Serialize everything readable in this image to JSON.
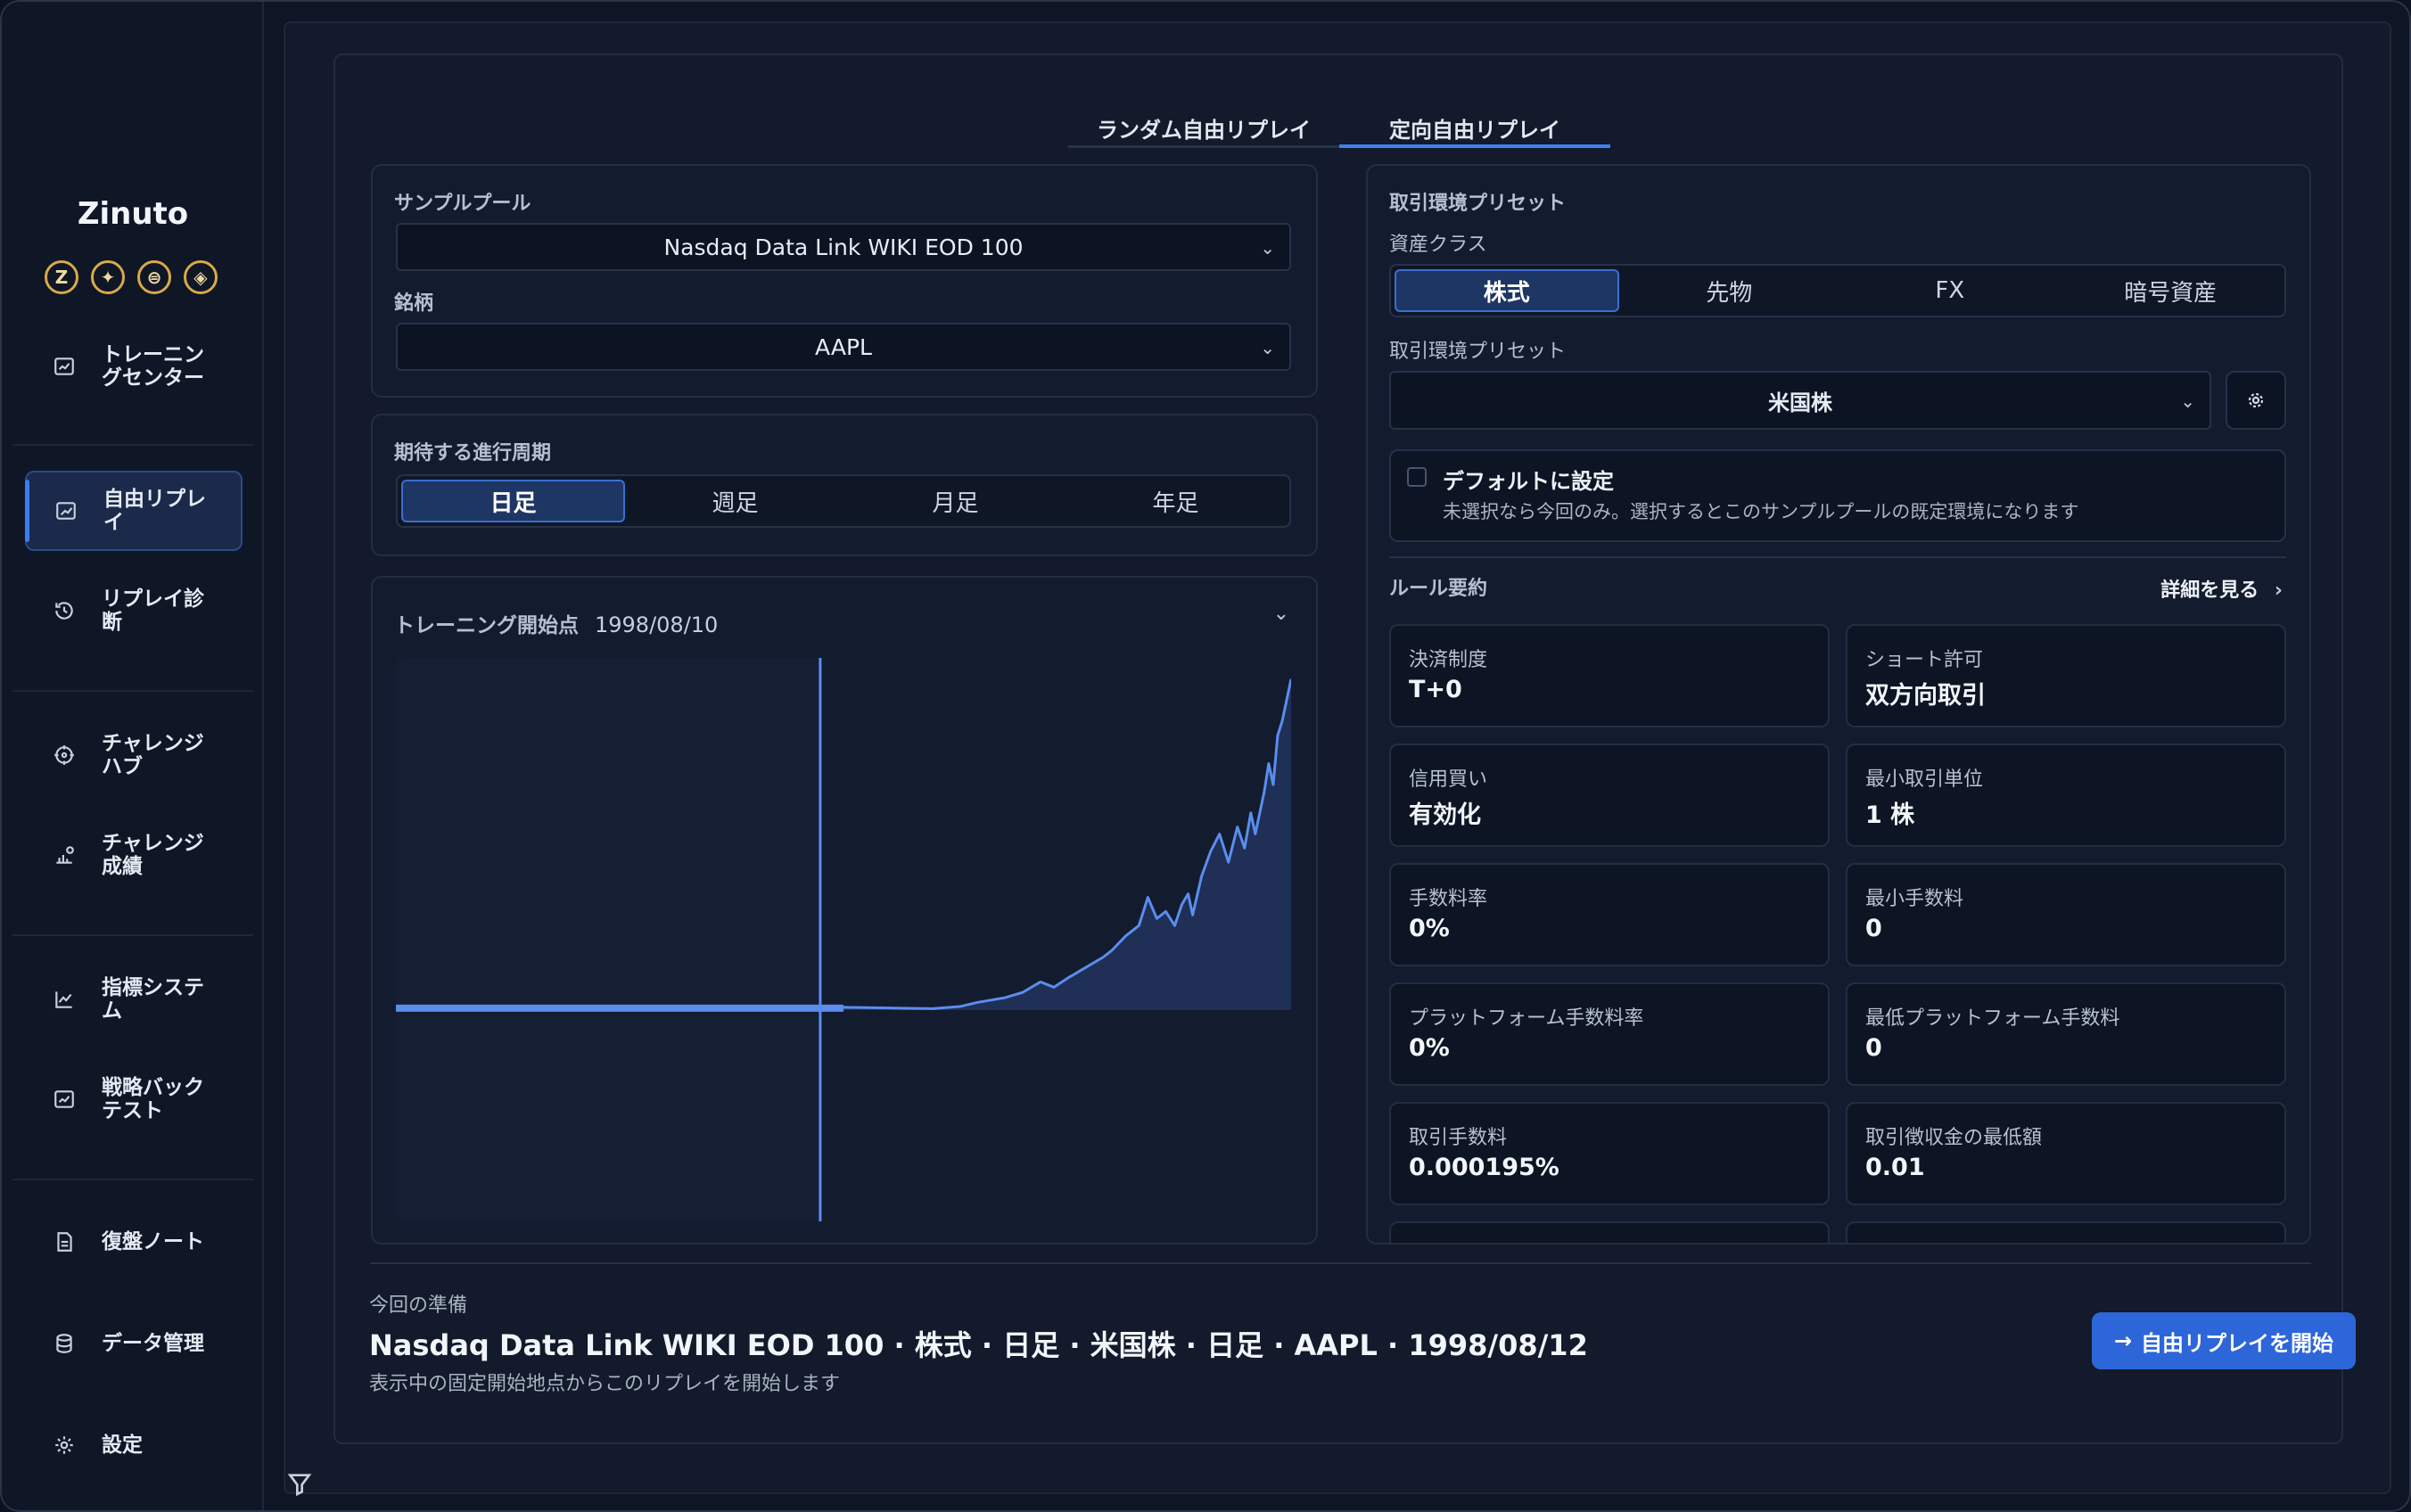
{
  "app": {
    "name": "Zinuto",
    "brand_icons": [
      "Z",
      "✦",
      "⊜",
      "◈"
    ]
  },
  "sidebar": {
    "items": [
      {
        "label": "トレーニングセンター",
        "icon": "training-icon"
      },
      {
        "label": "自由リプレイ",
        "icon": "chart-trend-icon",
        "active": true
      },
      {
        "label": "リプレイ診断",
        "icon": "history-icon"
      },
      {
        "label": "チャレンジハブ",
        "icon": "target-icon"
      },
      {
        "label": "チャレンジ成績",
        "icon": "score-icon"
      },
      {
        "label": "指標システム",
        "icon": "line-chart-icon"
      },
      {
        "label": "戦略バックテスト",
        "icon": "backtest-icon"
      },
      {
        "label": "復盤ノート",
        "icon": "note-icon"
      },
      {
        "label": "データ管理",
        "icon": "database-icon"
      },
      {
        "label": "設定",
        "icon": "gear-icon"
      }
    ]
  },
  "tabs": [
    {
      "label": "ランダム自由リプレイ"
    },
    {
      "label": "定向自由リプレイ",
      "active": true
    }
  ],
  "sample": {
    "pool_title": "サンプルプール",
    "pool_value": "Nasdaq Data Link WIKI EOD 100",
    "symbol_title": "銘柄",
    "symbol_value": "AAPL"
  },
  "period": {
    "title": "期待する進行周期",
    "options": [
      "日足",
      "週足",
      "月足",
      "年足"
    ],
    "selected": "日足"
  },
  "training_start": {
    "title": "トレーニング開始点",
    "date": "1998/08/10"
  },
  "chart_data": {
    "type": "area",
    "symbol": "AAPL",
    "title": "",
    "xlabel": "",
    "ylabel": "",
    "x": [
      0,
      5,
      10,
      15,
      20,
      25,
      30,
      35,
      40,
      45,
      47.4,
      50,
      55,
      60,
      63,
      65,
      68,
      70,
      72,
      73.5,
      75,
      77,
      79,
      80,
      81.5,
      83,
      84,
      85,
      86,
      87,
      87.8,
      88.5,
      89,
      90,
      91,
      92,
      93,
      94,
      94.8,
      95.5,
      96,
      97,
      97.5,
      98,
      98.5,
      99,
      99.5,
      100
    ],
    "values": [
      0.5,
      0.5,
      0.6,
      0.5,
      0.6,
      0.5,
      0.6,
      0.5,
      0.6,
      0.5,
      0.5,
      0.8,
      0.6,
      0.4,
      1.0,
      2.2,
      3.5,
      5.0,
      8.0,
      6.5,
      9.0,
      12.0,
      15.0,
      17.0,
      21.0,
      24.0,
      32.0,
      26.0,
      28.0,
      24.0,
      30.0,
      33.0,
      27.0,
      38.0,
      45.0,
      50.0,
      42.0,
      52.0,
      46.0,
      56.0,
      50.0,
      62.0,
      70.0,
      64.0,
      78.0,
      82.0,
      88.0,
      94.0
    ],
    "marker_x": 47.4,
    "xlim": [
      0,
      100
    ],
    "ylim": [
      -60,
      100
    ],
    "baseline": 0,
    "colors": {
      "line": "#5b8def",
      "fill": "#1f2f55",
      "marker": "#5b8def"
    }
  },
  "preset": {
    "title": "取引環境プリセット",
    "asset_class_title": "資産クラス",
    "asset_classes": [
      "株式",
      "先物",
      "FX",
      "暗号資産"
    ],
    "asset_selected": "株式",
    "preset_title": "取引環境プリセット",
    "preset_value": "米国株",
    "default_label": "デフォルトに設定",
    "default_desc": "未選択なら今回のみ。選択するとこのサンプルプールの既定環境になります"
  },
  "rules": {
    "title": "ルール要約",
    "details_link": "詳細を見る",
    "items": [
      {
        "label": "決済制度",
        "value": "T+0"
      },
      {
        "label": "ショート許可",
        "value": "双方向取引"
      },
      {
        "label": "信用買い",
        "value": "有効化"
      },
      {
        "label": "最小取引単位",
        "value": "1 株"
      },
      {
        "label": "手数料率",
        "value": "0%"
      },
      {
        "label": "最小手数料",
        "value": "0"
      },
      {
        "label": "プラットフォーム手数料率",
        "value": "0%"
      },
      {
        "label": "最低プラットフォーム手数料",
        "value": "0"
      },
      {
        "label": "取引手数料",
        "value": "0.000195%"
      },
      {
        "label": "取引徴収金の最低額",
        "value": "0.01"
      }
    ]
  },
  "prep": {
    "title": "今回の準備",
    "summary": "Nasdaq Data Link WIKI EOD 100 · 株式 · 日足 · 米国株 · 日足 · AAPL · 1998/08/12",
    "desc": "表示中の固定開始地点からこのリプレイを開始します",
    "start_button": "自由リプレイを開始"
  },
  "colors": {
    "accent": "#3f7ff0",
    "button": "#2d66d8",
    "background": "#0e1524"
  }
}
